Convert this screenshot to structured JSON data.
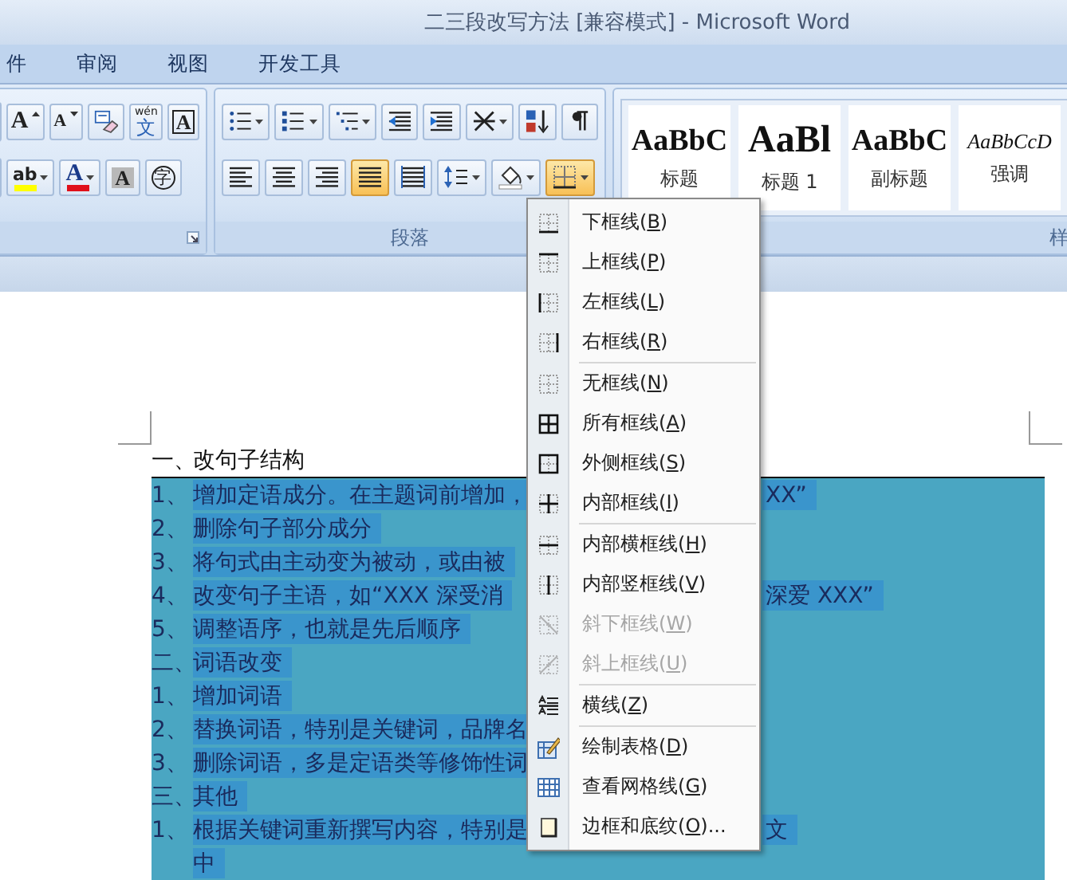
{
  "window": {
    "title": "二三段改写方法 [兼容模式] - Microsoft Word"
  },
  "tabs": [
    {
      "label": "件",
      "selected": false
    },
    {
      "label": "审阅",
      "selected": false
    },
    {
      "label": "视图",
      "selected": false
    },
    {
      "label": "开发工具",
      "selected": false
    }
  ],
  "ribbon": {
    "groups": [
      {
        "kind": "font",
        "rows": [
          [
            {
              "kind": "grow",
              "glyph": "A"
            },
            {
              "kind": "shrink",
              "glyph": "A"
            },
            {
              "kind": "clear"
            },
            {
              "kind": "phonetic",
              "glyph": "文",
              "ruby": "wén"
            },
            {
              "kind": "boxed",
              "glyph": "A"
            }
          ],
          [
            {
              "kind": "highlight",
              "glyph": "ab",
              "dropdown": true
            },
            {
              "kind": "font-color",
              "glyph": "A",
              "dropdown": true
            },
            {
              "kind": "shaded",
              "glyph": "A"
            },
            {
              "kind": "enclosed",
              "glyph": "字"
            }
          ]
        ]
      },
      {
        "kind": "paragraph",
        "label": "段落",
        "rows": [
          [
            {
              "kind": "bullets",
              "dropdown": true
            },
            {
              "kind": "numbering",
              "dropdown": true
            },
            {
              "kind": "multilevel",
              "dropdown": true
            },
            {
              "kind": "outdent"
            },
            {
              "kind": "indent"
            },
            {
              "kind": "asian-layout",
              "dropdown": true
            },
            {
              "kind": "sort"
            },
            {
              "kind": "marks"
            }
          ],
          [
            {
              "kind": "align-left",
              "selected": false
            },
            {
              "kind": "align-center",
              "selected": false
            },
            {
              "kind": "align-right",
              "selected": false
            },
            {
              "kind": "justify",
              "selected": true
            },
            {
              "kind": "distribute",
              "selected": false
            },
            {
              "kind": "line-spacing",
              "dropdown": true,
              "selected": false
            },
            {
              "kind": "shading",
              "dropdown": true,
              "selected": false
            },
            {
              "kind": "borders",
              "dropdown": true,
              "selected": true
            }
          ]
        ]
      },
      {
        "kind": "styles",
        "label": "样",
        "items": [
          {
            "kind": "title",
            "sample": "AaBbC",
            "name": "标题"
          },
          {
            "kind": "heading",
            "sample": "AaBl",
            "name": "标题 1"
          },
          {
            "kind": "subtitle",
            "sample": "AaBbC",
            "name": "副标题"
          },
          {
            "kind": "emphasis",
            "sample": "AaBbCcD",
            "name": "强调"
          }
        ]
      }
    ]
  },
  "document": {
    "lines": [
      {
        "marker": "一、",
        "text": "改句子结构",
        "selected": false
      },
      {
        "marker": "1、",
        "text": "增加定语成分。在主题词前增加，",
        "right": "XX”",
        "selected": true
      },
      {
        "marker": "2、",
        "text": "删除句子部分成分",
        "selected": true
      },
      {
        "marker": "3、",
        "text": "将句式由主动变为被动，或由被",
        "selected": true
      },
      {
        "marker": "4、",
        "text": "改变句子主语，如“XXX 深受消",
        "right": "深爱 XXX”",
        "selected": true
      },
      {
        "marker": "5、",
        "text": "调整语序，也就是先后顺序",
        "selected": true
      },
      {
        "marker": "二、",
        "text": "词语改变",
        "selected": true
      },
      {
        "marker": "1、",
        "text": "增加词语",
        "selected": true
      },
      {
        "marker": "2、",
        "text": "替换词语，特别是关键词，品牌名",
        "selected": true
      },
      {
        "marker": "3、",
        "text": "删除词语，多是定语类等修饰性词",
        "selected": true
      },
      {
        "marker": "三、",
        "text": "其他",
        "selected": true
      },
      {
        "marker": "1、",
        "text": "根据关键词重新撰写内容，特别是",
        "right": "文",
        "selected": true
      },
      {
        "text": "中",
        "selected": true
      }
    ]
  },
  "border_menu": {
    "items": [
      {
        "kind": "bottom",
        "label": "下框线(B)",
        "disabled": false
      },
      {
        "kind": "top",
        "label": "上框线(P)",
        "disabled": false
      },
      {
        "kind": "left",
        "label": "左框线(L)",
        "disabled": false
      },
      {
        "kind": "right",
        "label": "右框线(R)",
        "disabled": false
      },
      {
        "kind": "separator"
      },
      {
        "kind": "none",
        "label": "无框线(N)",
        "disabled": false
      },
      {
        "kind": "all",
        "label": "所有框线(A)",
        "disabled": false
      },
      {
        "kind": "outside",
        "label": "外侧框线(S)",
        "disabled": false
      },
      {
        "kind": "inside",
        "label": "内部框线(I)",
        "disabled": false
      },
      {
        "kind": "separator"
      },
      {
        "kind": "inside-h",
        "label": "内部横框线(H)",
        "disabled": false
      },
      {
        "kind": "inside-v",
        "label": "内部竖框线(V)",
        "disabled": false
      },
      {
        "kind": "diag-down",
        "label": "斜下框线(W)",
        "disabled": true
      },
      {
        "kind": "diag-up",
        "label": "斜上框线(U)",
        "disabled": true
      },
      {
        "kind": "separator"
      },
      {
        "kind": "hline",
        "label": "横线(Z)",
        "disabled": false
      },
      {
        "kind": "separator"
      },
      {
        "kind": "draw-table",
        "label": "绘制表格(D)",
        "disabled": false
      },
      {
        "kind": "grid",
        "label": "查看网格线(G)",
        "disabled": false
      },
      {
        "kind": "borders-shading",
        "label": "边框和底纹(O)...",
        "disabled": false
      }
    ]
  }
}
